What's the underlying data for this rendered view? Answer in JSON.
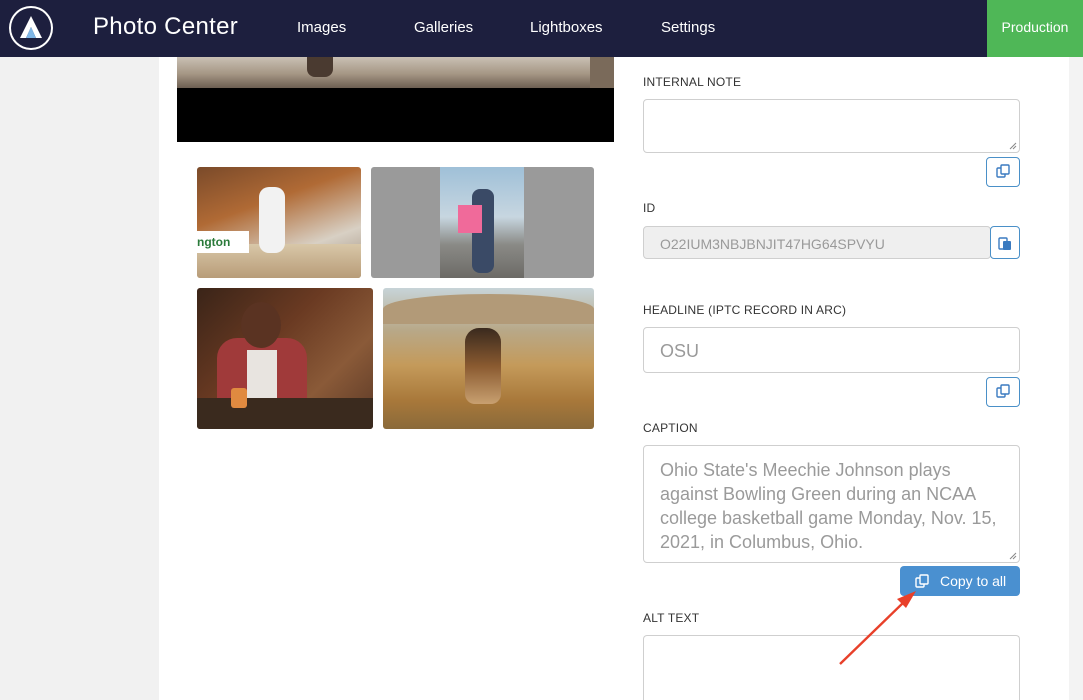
{
  "app": {
    "title": "Photo Center",
    "logo_icon": "arc-logo-icon"
  },
  "nav": {
    "items": [
      {
        "label": "Images"
      },
      {
        "label": "Galleries"
      },
      {
        "label": "Lightboxes"
      },
      {
        "label": "Settings"
      }
    ]
  },
  "environment": {
    "label": "Production",
    "color": "#4fb757"
  },
  "fields": {
    "internal_note": {
      "label": "INTERNAL NOTE",
      "value": ""
    },
    "id": {
      "label": "ID",
      "value": "O22IUM3NBJBNJIT47HG64SPVYU"
    },
    "headline": {
      "label": "HEADLINE (IPTC RECORD IN ARC)",
      "value": "OSU"
    },
    "caption": {
      "label": "CAPTION",
      "value": "Ohio State's Meechie Johnson plays against Bowling Green during an NCAA college basketball game Monday, Nov. 15, 2021, in Columbus, Ohio."
    },
    "alt_text": {
      "label": "ALT TEXT",
      "value": ""
    }
  },
  "buttons": {
    "copy_to_all": "Copy to all"
  },
  "colors": {
    "topbar": "#1d1f3e",
    "accent": "#4a90d0",
    "annotation_arrow": "#e8402a"
  }
}
